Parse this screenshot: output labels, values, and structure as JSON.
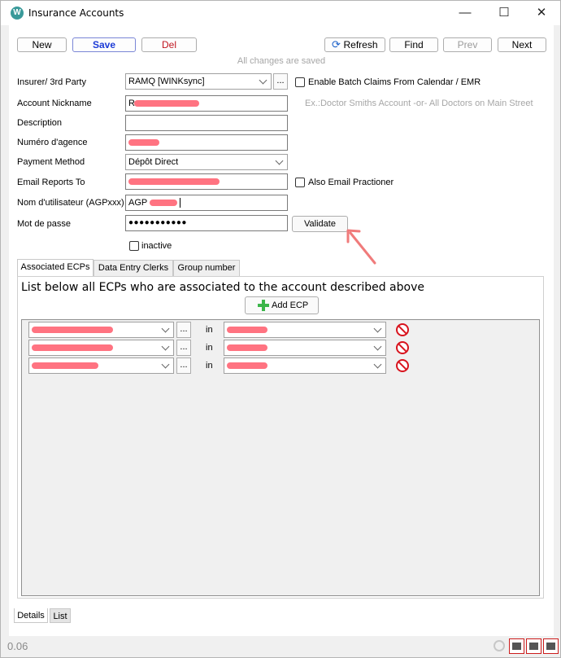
{
  "window": {
    "title": "Insurance Accounts",
    "app_icon": "W",
    "controls": {
      "minimize": "—",
      "maximize": "☐",
      "close": "✕"
    }
  },
  "toolbar": {
    "new_label": "New",
    "save_label": "Save",
    "del_label": "Del",
    "refresh_label": "Refresh",
    "find_label": "Find",
    "prev_label": "Prev",
    "next_label": "Next",
    "status_text": "All changes are saved"
  },
  "form": {
    "insurer_label": "Insurer/ 3rd Party",
    "insurer_value": "RAMQ [WINKsync]",
    "batch_claims_label": "Enable Batch Claims From Calendar / EMR",
    "nickname_label": "Account Nickname",
    "nickname_value": "R",
    "nickname_hint": "Ex.:Doctor Smiths Account -or- All Doctors on Main Street",
    "description_label": "Description",
    "description_value": "",
    "agency_label": "Numéro d'agence",
    "agency_value": "",
    "payment_label": "Payment Method",
    "payment_value": "Dépôt Direct",
    "email_label": "Email Reports To",
    "email_value": "",
    "also_email_label": "Also Email Practioner",
    "username_label": "Nom d'utilisateur (AGPxxx)",
    "username_value": "AGP",
    "password_label": "Mot de passe",
    "password_value": "●●●●●●●●●●●",
    "validate_label": "Validate",
    "inactive_label": "inactive",
    "browse_label": "..."
  },
  "tabs": [
    {
      "label": "Associated ECPs"
    },
    {
      "label": "Data Entry Clerks"
    },
    {
      "label": "Group number"
    }
  ],
  "ecp_panel": {
    "description": "List below all ECPs who are associated to the account described above",
    "add_label": "Add ECP",
    "rows": [
      {
        "ecp": "",
        "in_label": "in",
        "location": ""
      },
      {
        "ecp": "",
        "in_label": "in",
        "location": ""
      },
      {
        "ecp": "",
        "in_label": "in",
        "location": ""
      }
    ]
  },
  "bottom_tabs": [
    {
      "label": "Details"
    },
    {
      "label": "List"
    }
  ],
  "footer": {
    "version": "0.06"
  },
  "colors": {
    "save_text": "#1c3bd6",
    "del_text": "#c0141e",
    "add_icon": "#3cb64a",
    "delete_icon": "#d8141e",
    "annotation_arrow": "#f07b7b"
  }
}
